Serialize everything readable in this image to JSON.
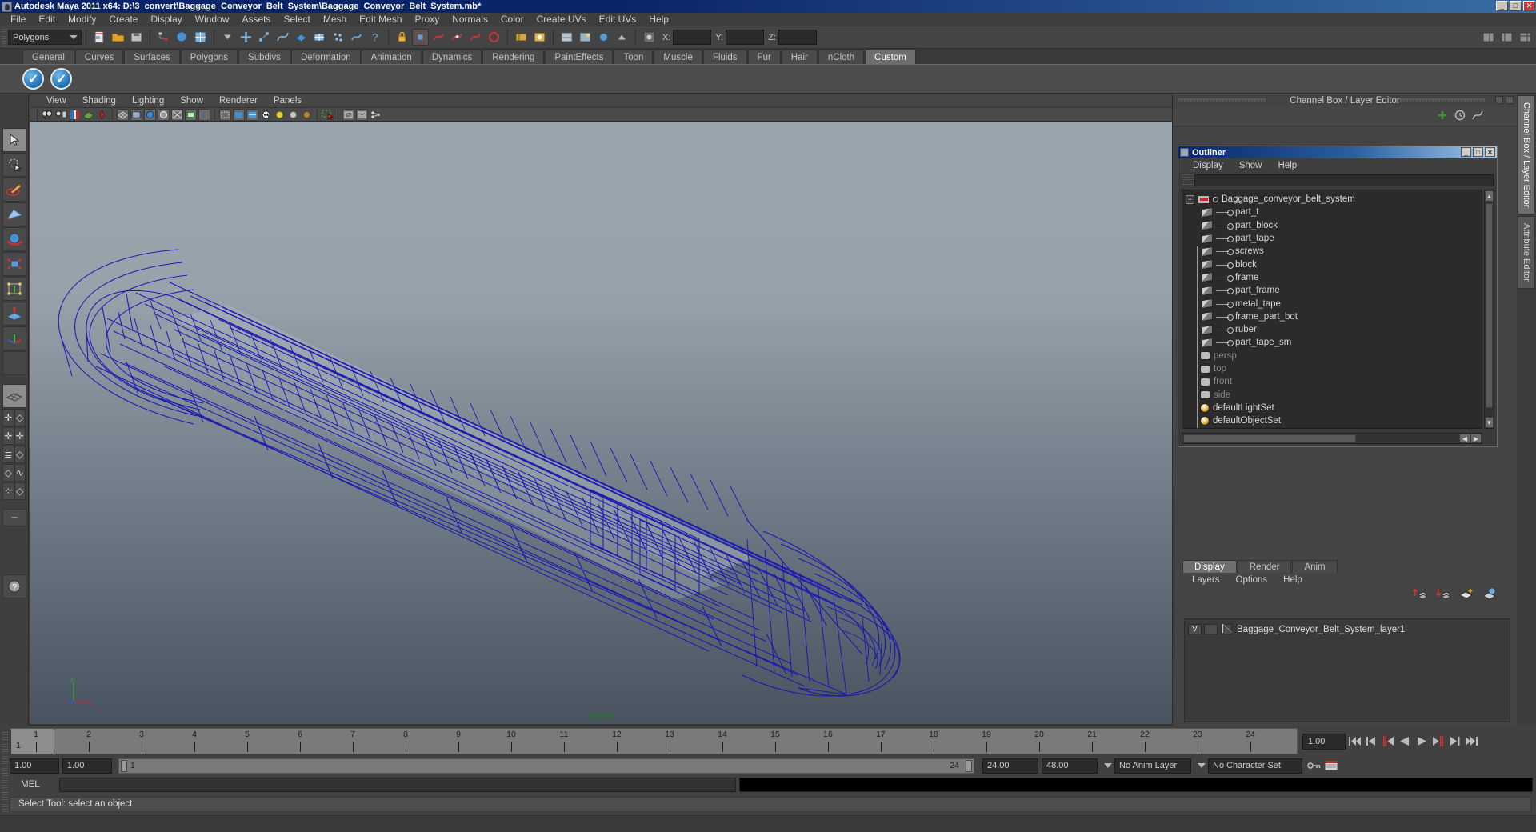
{
  "window": {
    "title": "Autodesk Maya 2011 x64: D:\\3_convert\\Baggage_Conveyor_Belt_System\\Baggage_Conveyor_Belt_System.mb*",
    "minimize": "_",
    "maximize": "□",
    "close": "✕",
    "app_icon": "maya-icon"
  },
  "menubar": {
    "items": [
      "File",
      "Edit",
      "Modify",
      "Create",
      "Display",
      "Window",
      "Assets",
      "Select",
      "Mesh",
      "Edit Mesh",
      "Proxy",
      "Normals",
      "Color",
      "Create UVs",
      "Edit UVs",
      "Help"
    ]
  },
  "statusline": {
    "mode_selector": "Polygons",
    "x_label": "X:",
    "y_label": "Y:",
    "z_label": "Z:",
    "x_value": "",
    "y_value": "",
    "z_value": ""
  },
  "shelf": {
    "tabs": [
      "General",
      "Curves",
      "Surfaces",
      "Polygons",
      "Subdivs",
      "Deformation",
      "Animation",
      "Dynamics",
      "Rendering",
      "PaintEffects",
      "Toon",
      "Muscle",
      "Fluids",
      "Fur",
      "Hair",
      "nCloth",
      "Custom"
    ],
    "active_tab": "Custom",
    "buttons": [
      "check-blue-icon",
      "check-blue-icon"
    ]
  },
  "toolbox": {
    "items": [
      {
        "name": "select-tool",
        "glyph": "➤",
        "selected": true
      },
      {
        "name": "lasso-select-tool",
        "glyph": "◌",
        "selected": false
      },
      {
        "name": "paint-select-tool",
        "glyph": "✎",
        "selected": false
      },
      {
        "name": "move-tool",
        "glyph": "✥",
        "selected": false
      },
      {
        "name": "rotate-tool",
        "glyph": "⟳",
        "selected": false
      },
      {
        "name": "scale-tool",
        "glyph": "⬌",
        "selected": false
      },
      {
        "name": "universal-manipulator-tool",
        "glyph": "⬚",
        "selected": false
      },
      {
        "name": "soft-modification-tool",
        "glyph": "⇡",
        "selected": false
      },
      {
        "name": "last-tool-used",
        "glyph": "⊹",
        "selected": false
      },
      {
        "name": "empty-slot",
        "glyph": "",
        "selected": false
      }
    ],
    "layout_buttons": [
      "single-perspective-layout",
      "four-view-layout",
      "persp-outliner-layout",
      "persp-graph-editor-layout",
      "hypershade-persp-layout"
    ]
  },
  "viewport": {
    "menus": [
      "View",
      "Shading",
      "Lighting",
      "Show",
      "Renderer",
      "Panels"
    ],
    "camera_label": "persp",
    "axis": {
      "x": "x",
      "y": "y",
      "z": "z"
    },
    "toolbar_icons": [
      "select-camera-icon",
      "camera-attributes-icon",
      "bookmarks-icon",
      "image-plane-icon",
      "keyframe-icon",
      "wireframe-icon",
      "smooth-shade-icon",
      "textured-icon",
      "lighting-icon",
      "xray-icon",
      "shadows-icon",
      "text-icon",
      "bounding-box-icon",
      "flat-shade-icon",
      "smooth-shade-all-icon",
      "hw-texturing-icon",
      "use-default-light-icon",
      "use-all-lights-icon",
      "shadow-icon",
      "isolate-select-icon",
      "xray-joints-icon",
      "exposure-icon",
      "gamma-icon"
    ],
    "model_color": "#1515b4",
    "bg_top": "#9aa4ac",
    "bg_bottom": "#4a5360"
  },
  "channelbox": {
    "header": "Channel Box / Layer Editor"
  },
  "outliner": {
    "title": "Outliner",
    "window_buttons": [
      "_",
      "□",
      "✕"
    ],
    "menus": [
      "Display",
      "Show",
      "Help"
    ],
    "search_value": "",
    "root": {
      "label": "Baggage_conveyor_belt_system",
      "expanded": true
    },
    "children": [
      "part_t",
      "part_block",
      "part_tape",
      "screws",
      "block",
      "frame",
      "part_frame",
      "metal_tape",
      "frame_part_bot",
      "ruber",
      "part_tape_sm"
    ],
    "cameras": [
      "persp",
      "top",
      "front",
      "side"
    ],
    "sets": [
      "defaultLightSet",
      "defaultObjectSet"
    ]
  },
  "layer_editor": {
    "tabs": [
      "Display",
      "Render",
      "Anim"
    ],
    "active_tab": "Display",
    "menus": [
      "Layers",
      "Options",
      "Help"
    ],
    "toolbar_icons": [
      "move-layer-up-icon",
      "move-layer-down-icon",
      "new-layer-icon",
      "new-layer-from-selected-icon"
    ],
    "layers": [
      {
        "visibility": "V",
        "playback": "",
        "name": "Baggage_Conveyor_Belt_System_layer1"
      }
    ]
  },
  "right_tabs": [
    {
      "label": "Channel Box / Layer Editor",
      "active": true
    },
    {
      "label": "Attribute Editor",
      "active": false
    }
  ],
  "timeslider": {
    "ticks": [
      1,
      2,
      3,
      4,
      5,
      6,
      7,
      8,
      9,
      10,
      11,
      12,
      13,
      14,
      15,
      16,
      17,
      18,
      19,
      20,
      21,
      22,
      23,
      24
    ],
    "current_frame_label": "1",
    "current_time_field": "1.00",
    "playback_buttons": [
      "go-to-start-icon",
      "step-back-keyframe-icon",
      "step-back-frame-icon",
      "play-backwards-icon",
      "play-forwards-icon",
      "step-forward-frame-icon",
      "step-forward-keyframe-icon",
      "go-to-end-icon"
    ]
  },
  "rangeslider": {
    "start_field": "1.00",
    "range_start_field": "1.00",
    "bar_start_label": "1",
    "bar_end_label": "24",
    "range_end_field": "24.00",
    "end_field": "48.00",
    "anim_layer": "No Anim Layer",
    "character_set": "No Character Set",
    "extra_icons": [
      "auto-key-icon",
      "animation-preferences-icon"
    ]
  },
  "commandline": {
    "label": "MEL",
    "input_value": "",
    "result_value": ""
  },
  "helpline": {
    "message": "Select Tool: select an object"
  }
}
